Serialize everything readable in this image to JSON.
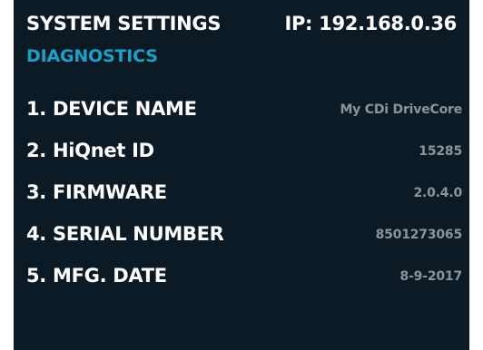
{
  "header": {
    "title": "SYSTEM SETTINGS",
    "ip": "IP: 192.168.0.36"
  },
  "section": {
    "title": "DIAGNOSTICS"
  },
  "items": [
    {
      "label": "1. DEVICE NAME",
      "value": "My CDi DriveCore"
    },
    {
      "label": "2. HiQnet ID",
      "value": "15285"
    },
    {
      "label": "3. FIRMWARE",
      "value": "2.0.4.0"
    },
    {
      "label": "4. SERIAL NUMBER",
      "value": "8501273065"
    },
    {
      "label": "5. MFG. DATE",
      "value": "8-9-2017"
    }
  ],
  "colors": {
    "background": "#0c1a26",
    "accent": "#1ea0c6",
    "label": "#ffffff",
    "value": "#8a949c"
  }
}
